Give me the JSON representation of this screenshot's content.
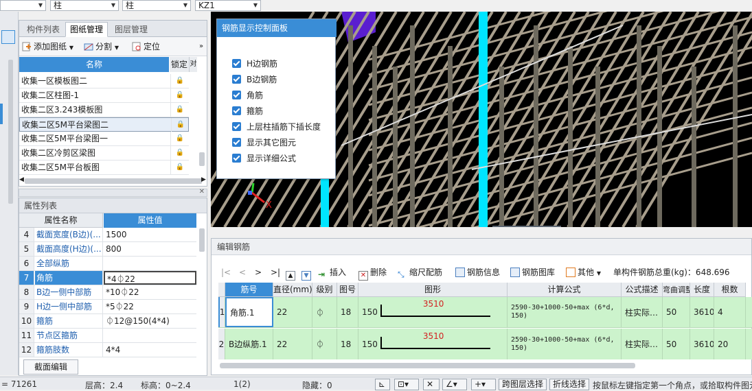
{
  "topbar": {
    "combo1": "",
    "combo2": "柱",
    "combo3": "柱",
    "combo4": "KZ1"
  },
  "drawings_panel": {
    "tabs": [
      "构件列表",
      "图纸管理",
      "图层管理"
    ],
    "active_tab": "图纸管理",
    "toolbar": {
      "add": "添加图纸",
      "split": "分割",
      "locate": "定位",
      "more": "»"
    },
    "columns": {
      "name": "名称",
      "lock": "锁定",
      "extra": "对"
    },
    "rows": [
      {
        "name": "收集一区模板图二"
      },
      {
        "name": "收集二区柱图-1"
      },
      {
        "name": "收集二区3.243模板图"
      },
      {
        "name": "收集二区5M平台梁图二"
      },
      {
        "name": "收集二区5M平台梁图一"
      },
      {
        "name": "收集二区冷剪区梁图"
      },
      {
        "name": "收集二区5M平台板图"
      }
    ],
    "selected_row": 3
  },
  "props_panel": {
    "title": "属性列表",
    "columns": {
      "name": "属性名称",
      "value": "属性值"
    },
    "rows": [
      {
        "num": "4",
        "name": "截面宽度(B边)(...",
        "value": "1500"
      },
      {
        "num": "5",
        "name": "截面高度(H边)(...",
        "value": "800"
      },
      {
        "num": "6",
        "name": "全部纵筋",
        "value": ""
      },
      {
        "num": "7",
        "name": "角筋",
        "value": "*4⏀22"
      },
      {
        "num": "8",
        "name": "B边一侧中部筋",
        "value": "*10⏀22"
      },
      {
        "num": "9",
        "name": "H边一侧中部筋",
        "value": "*5⏀22"
      },
      {
        "num": "10",
        "name": "箍筋",
        "value": "⏀12@150(4*4)"
      },
      {
        "num": "11",
        "name": "节点区箍筋",
        "value": ""
      },
      {
        "num": "12",
        "name": "箍筋肢数",
        "value": "4*4"
      }
    ],
    "selected_row": 3,
    "edit_button": "截面编辑"
  },
  "control_panel": {
    "title": "钢筋显示控制面板",
    "items": [
      "H边钢筋",
      "B边钢筋",
      "角筋",
      "箍筋",
      "上层柱插筋下插长度",
      "显示其它图元",
      "显示详细公式"
    ]
  },
  "axis": {
    "x": "X"
  },
  "edit_panel": {
    "title": "编辑钢筋",
    "nav": [
      "|<",
      "<",
      ">",
      ">|"
    ],
    "toolbar": {
      "insert": "插入",
      "delete": "删除",
      "scale": "缩尺配筋",
      "info": "钢筋信息",
      "library": "钢筋图库",
      "other": "其他",
      "total": "单构件钢筋总重(kg)：648.696"
    },
    "columns": [
      "筋号",
      "直径(mm)",
      "级别",
      "图号",
      "图形",
      "计算公式",
      "公式描述",
      "弯曲调整",
      "长度",
      "根数"
    ],
    "rows": [
      {
        "idx": "1",
        "name": "角筋.1",
        "diameter": "22",
        "grade": "⏀",
        "fig": "18",
        "left": "150",
        "dim": "3510",
        "formula": "2590-30+1000-50+max (6*d, 150)",
        "desc": "柱实际…",
        "bend": "50",
        "length": "3610",
        "count": "4"
      },
      {
        "idx": "2",
        "name": "B边纵筋.1",
        "diameter": "22",
        "grade": "⏀",
        "fig": "18",
        "left": "150",
        "dim": "3510",
        "formula": "2590-30+1000-50+max (6*d, 150)",
        "desc": "柱实际…",
        "bend": "50",
        "length": "3610",
        "count": "20"
      }
    ]
  },
  "status": {
    "coord": "= 71261",
    "floor_h": "层高：2.4",
    "elev": "标高：0~2.4",
    "page": "1(2)",
    "hidden": "隐藏：0",
    "btn_cross": "跨图层选择",
    "btn_fold": "折线选择",
    "hint": "按鼠标左键指定第一个角点，或拾取构件图元"
  },
  "colors": {
    "accent": "#3a8dd6",
    "row_green": "#ccf3cc",
    "cyan_bar": "#00e5ff",
    "rebar": "#a89e8c"
  }
}
